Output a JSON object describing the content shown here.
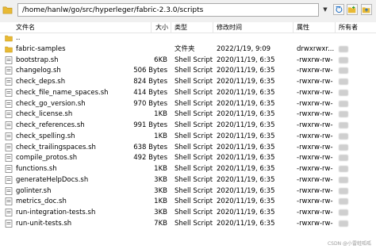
{
  "path": "/home/hanlw/go/src/hyperleger/fabric-2.3.0/scripts",
  "columns": {
    "name": "文件名",
    "size": "大小",
    "type": "类型",
    "modified": "修改时间",
    "attr": "属性",
    "owner": "所有者"
  },
  "rows": [
    {
      "name": "..",
      "size": "",
      "type": "",
      "modified": "",
      "attr": "",
      "kind": "folder"
    },
    {
      "name": "fabric-samples",
      "size": "",
      "type": "文件夹",
      "modified": "2022/1/19, 9:09",
      "attr": "drwxrwxr...",
      "kind": "folder"
    },
    {
      "name": "bootstrap.sh",
      "size": "6KB",
      "type": "Shell Script",
      "modified": "2020/11/19, 6:35",
      "attr": "-rwxrw-rw-",
      "kind": "file"
    },
    {
      "name": "changelog.sh",
      "size": "506 Bytes",
      "type": "Shell Script",
      "modified": "2020/11/19, 6:35",
      "attr": "-rwxrw-rw-",
      "kind": "file"
    },
    {
      "name": "check_deps.sh",
      "size": "824 Bytes",
      "type": "Shell Script",
      "modified": "2020/11/19, 6:35",
      "attr": "-rwxrw-rw-",
      "kind": "file"
    },
    {
      "name": "check_file_name_spaces.sh",
      "size": "414 Bytes",
      "type": "Shell Script",
      "modified": "2020/11/19, 6:35",
      "attr": "-rwxrw-rw-",
      "kind": "file"
    },
    {
      "name": "check_go_version.sh",
      "size": "970 Bytes",
      "type": "Shell Script",
      "modified": "2020/11/19, 6:35",
      "attr": "-rwxrw-rw-",
      "kind": "file"
    },
    {
      "name": "check_license.sh",
      "size": "1KB",
      "type": "Shell Script",
      "modified": "2020/11/19, 6:35",
      "attr": "-rwxrw-rw-",
      "kind": "file"
    },
    {
      "name": "check_references.sh",
      "size": "991 Bytes",
      "type": "Shell Script",
      "modified": "2020/11/19, 6:35",
      "attr": "-rwxrw-rw-",
      "kind": "file"
    },
    {
      "name": "check_spelling.sh",
      "size": "1KB",
      "type": "Shell Script",
      "modified": "2020/11/19, 6:35",
      "attr": "-rwxrw-rw-",
      "kind": "file"
    },
    {
      "name": "check_trailingspaces.sh",
      "size": "638 Bytes",
      "type": "Shell Script",
      "modified": "2020/11/19, 6:35",
      "attr": "-rwxrw-rw-",
      "kind": "file"
    },
    {
      "name": "compile_protos.sh",
      "size": "492 Bytes",
      "type": "Shell Script",
      "modified": "2020/11/19, 6:35",
      "attr": "-rwxrw-rw-",
      "kind": "file"
    },
    {
      "name": "functions.sh",
      "size": "1KB",
      "type": "Shell Script",
      "modified": "2020/11/19, 6:35",
      "attr": "-rwxrw-rw-",
      "kind": "file"
    },
    {
      "name": "generateHelpDocs.sh",
      "size": "3KB",
      "type": "Shell Script",
      "modified": "2020/11/19, 6:35",
      "attr": "-rwxrw-rw-",
      "kind": "file"
    },
    {
      "name": "golinter.sh",
      "size": "3KB",
      "type": "Shell Script",
      "modified": "2020/11/19, 6:35",
      "attr": "-rwxrw-rw-",
      "kind": "file"
    },
    {
      "name": "metrics_doc.sh",
      "size": "1KB",
      "type": "Shell Script",
      "modified": "2020/11/19, 6:35",
      "attr": "-rwxrw-rw-",
      "kind": "file"
    },
    {
      "name": "run-integration-tests.sh",
      "size": "3KB",
      "type": "Shell Script",
      "modified": "2020/11/19, 6:35",
      "attr": "-rwxrw-rw-",
      "kind": "file"
    },
    {
      "name": "run-unit-tests.sh",
      "size": "7KB",
      "type": "Shell Script",
      "modified": "2020/11/19, 6:35",
      "attr": "-rwxrw-rw-",
      "kind": "file"
    }
  ],
  "watermark": "CSDN @小雷蛙呱呱",
  "colors": {
    "folder": "#e8b934",
    "accent": "#1e6fc7"
  }
}
